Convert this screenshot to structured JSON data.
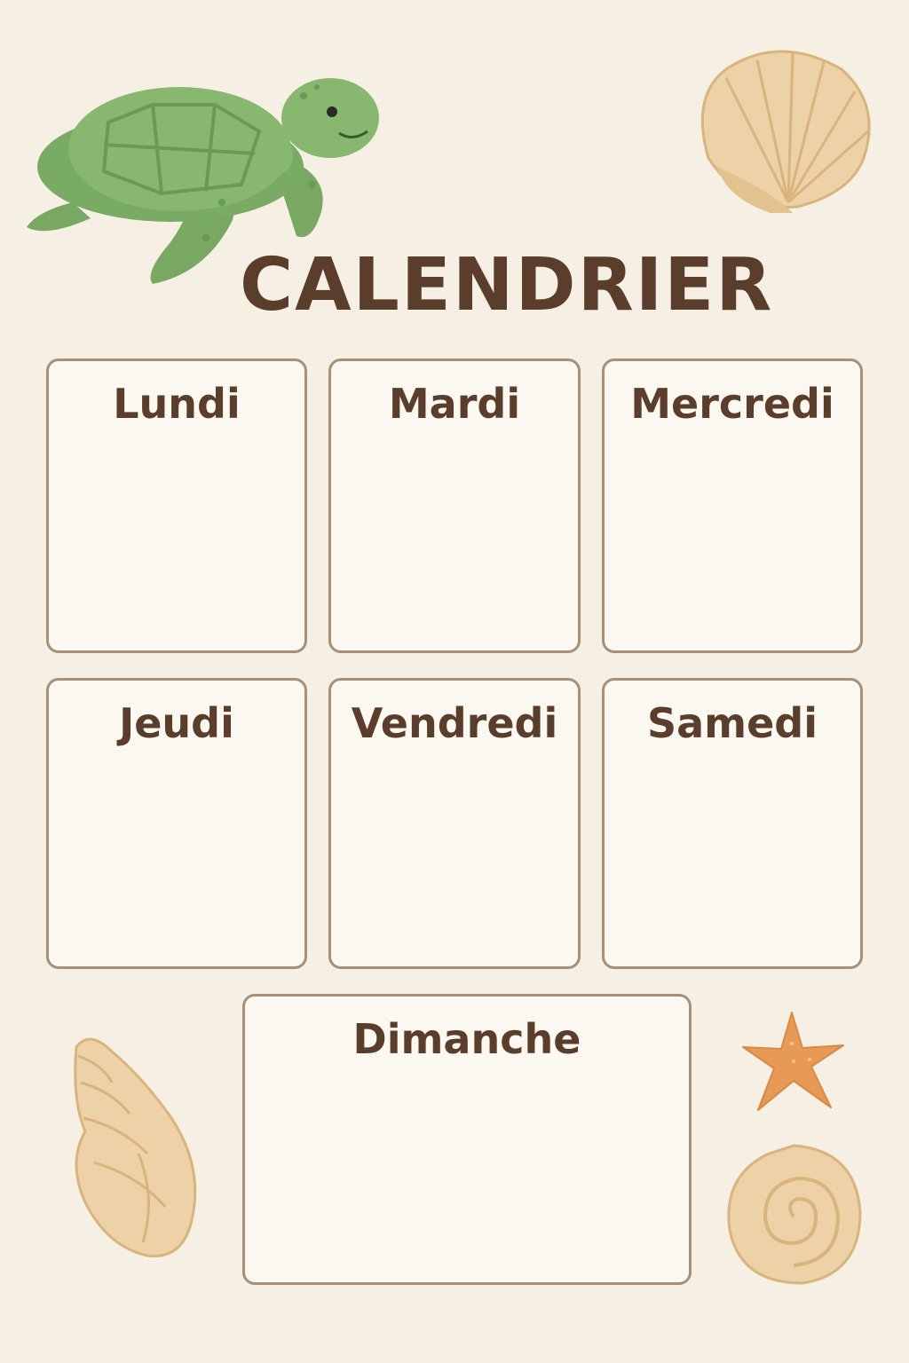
{
  "calendar": {
    "title": "CALENDRIER",
    "days": {
      "monday": "Lundi",
      "tuesday": "Mardi",
      "wednesday": "Mercredi",
      "thursday": "Jeudi",
      "friday": "Vendredi",
      "saturday": "Samedi",
      "sunday": "Dimanche"
    }
  },
  "colors": {
    "background": "#f6efe4",
    "text": "#5a3d2b",
    "box_border": "#a89078",
    "box_fill": "#fbf7f1",
    "turtle": "#7fae68",
    "shell": "#ecd2a6",
    "starfish": "#e79a55"
  },
  "decorations": [
    "sea-turtle",
    "scallop-shell",
    "conch-shell",
    "starfish",
    "spiral-shell"
  ]
}
